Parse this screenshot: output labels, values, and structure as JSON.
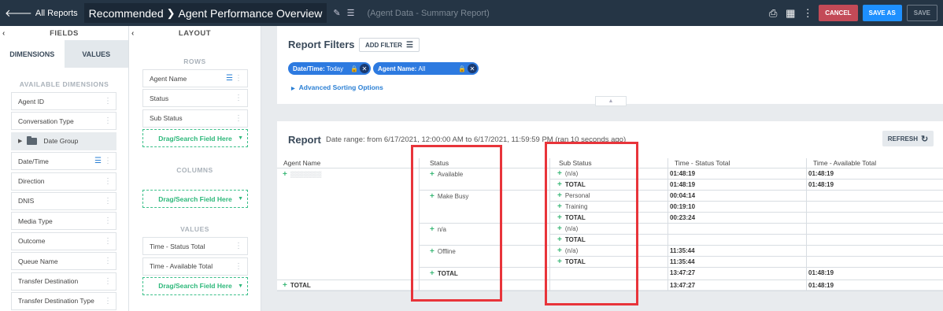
{
  "topbar": {
    "back_label": "All Reports",
    "crumb1": "Recommended",
    "crumb2": "Agent Performance Overview",
    "subtitle": "(Agent Data - Summary Report)",
    "cancel": "CANCEL",
    "save_as": "SAVE AS",
    "save": "SAVE"
  },
  "fields": {
    "header": "FIELDS",
    "tab_dimensions": "DIMENSIONS",
    "tab_values": "VALUES",
    "section": "AVAILABLE DIMENSIONS",
    "items": [
      "Agent ID",
      "Conversation Type",
      "Date Group",
      "Date/Time",
      "Direction",
      "DNIS",
      "Media Type",
      "Outcome",
      "Queue Name",
      "Transfer Destination",
      "Transfer Destination Type"
    ]
  },
  "layout": {
    "header": "LAYOUT",
    "rows_label": "ROWS",
    "rows": [
      "Agent Name",
      "Status",
      "Sub Status"
    ],
    "columns_label": "COLUMNS",
    "values_label": "VALUES",
    "values": [
      "Time - Status Total",
      "Time - Available Total"
    ],
    "drop_text": "Drag/Search Field Here"
  },
  "filters": {
    "title": "Report Filters",
    "add_filter": "ADD FILTER",
    "chip1_key": "Date/Time:",
    "chip1_val": "Today",
    "chip2_key": "Agent Name:",
    "chip2_val": "All",
    "advanced": "Advanced Sorting Options"
  },
  "report": {
    "title": "Report",
    "range": "Date range: from 6/17/2021, 12:00:00 AM to 6/17/2021, 11:59:59 PM (ran 10 seconds ago)",
    "refresh": "REFRESH",
    "headers": [
      "Agent Name",
      "Status",
      "Sub Status",
      "Time - Status Total",
      "Time - Available Total"
    ],
    "statuses": [
      "Available",
      "Make Busy",
      "n/a",
      "Offline",
      "TOTAL"
    ],
    "rows": [
      {
        "sub": "(n/a)",
        "t1": "01:48:19",
        "t2": "01:48:19"
      },
      {
        "sub": "TOTAL",
        "t1": "01:48:19",
        "t2": "01:48:19"
      },
      {
        "sub": "Personal",
        "t1": "00:04:14",
        "t2": ""
      },
      {
        "sub": "Training",
        "t1": "00:19:10",
        "t2": ""
      },
      {
        "sub": "TOTAL",
        "t1": "00:23:24",
        "t2": ""
      },
      {
        "sub": "(n/a)",
        "t1": "",
        "t2": ""
      },
      {
        "sub": "TOTAL",
        "t1": "",
        "t2": ""
      },
      {
        "sub": "(n/a)",
        "t1": "11:35:44",
        "t2": ""
      },
      {
        "sub": "TOTAL",
        "t1": "11:35:44",
        "t2": ""
      },
      {
        "sub": "",
        "t1": "13:47:27",
        "t2": "01:48:19"
      }
    ],
    "grand_total_label": "TOTAL",
    "grand_total": {
      "t1": "13:47:27",
      "t2": "01:48:19"
    }
  }
}
